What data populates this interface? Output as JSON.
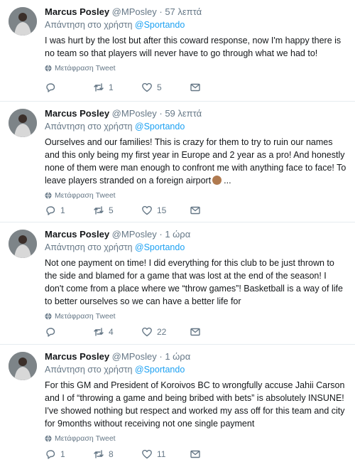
{
  "tweets": [
    {
      "name": "Marcus Posley",
      "handle": "@MPosley",
      "sep": "·",
      "time": "57 λεπτά",
      "reply_prefix": "Απάντηση στο χρήστη",
      "reply_mention": "@Sportando",
      "text": "I was hurt by the lost but after this coward response, now I'm happy there is no team so that players will never have to go through what we had to!",
      "translate": "Μετάφραση Tweet",
      "replies": "",
      "retweets": "1",
      "likes": "5"
    },
    {
      "name": "Marcus Posley",
      "handle": "@MPosley",
      "sep": "·",
      "time": "59 λεπτά",
      "reply_prefix": "Απάντηση στο χρήστη",
      "reply_mention": "@Sportando",
      "text": "Ourselves and our families! This is crazy for them to try to ruin our names and this only being my first year in Europe and 2 year as a pro! And honestly none of them were man enough to confront me with anything face to face! To leave players stranded on a foreign airport",
      "text_suffix": "...",
      "emoji": "ok-hand-emoji",
      "translate": "Μετάφραση Tweet",
      "replies": "1",
      "retweets": "5",
      "likes": "15"
    },
    {
      "name": "Marcus Posley",
      "handle": "@MPosley",
      "sep": "·",
      "time": "1 ώρα",
      "reply_prefix": "Απάντηση στο χρήστη",
      "reply_mention": "@Sportando",
      "text": "Not one payment on time! I did everything for this club to be just thrown to the side and blamed for a game that was lost at the end of the season! I don't come from a place where we “throw games”! Basketball is a way of life to better ourselves so we can have a better life for",
      "translate": "Μετάφραση Tweet",
      "replies": "",
      "retweets": "4",
      "likes": "22"
    },
    {
      "name": "Marcus Posley",
      "handle": "@MPosley",
      "sep": "·",
      "time": "1 ώρα",
      "reply_prefix": "Απάντηση στο χρήστη",
      "reply_mention": "@Sportando",
      "text": "For this GM and President of Koroivos BC to wrongfully accuse Jahii Carson and I of “throwing a game and being bribed with bets” is absolutely INSUNE! I've showed nothing but respect and worked my ass off for this team and city for 9months without receiving not one single payment",
      "translate": "Μετάφραση Tweet",
      "replies": "1",
      "retweets": "8",
      "likes": "11"
    }
  ],
  "colors": {
    "accent": "#1da1f2",
    "muted": "#657786",
    "text": "#14171a"
  },
  "icons": [
    "reply-icon",
    "retweet-icon",
    "like-icon",
    "message-icon",
    "globe-icon"
  ]
}
